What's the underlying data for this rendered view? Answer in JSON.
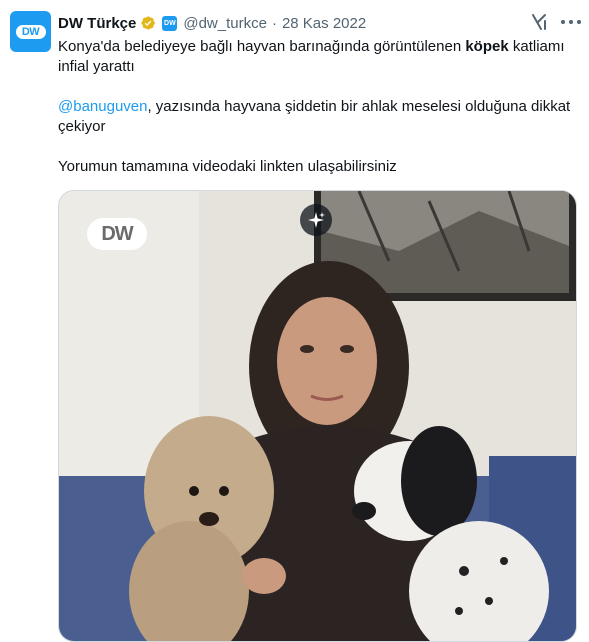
{
  "tweet": {
    "avatar_text": "DW",
    "author_name": "DW Türkçe",
    "affiliate_badge": "DW",
    "handle": "@dw_turkce",
    "separator": "·",
    "date": "28 Kas 2022",
    "line1_before": "Konya'da belediyeye bağlı hayvan barınağında görüntülenen ",
    "line1_bold": "köpek",
    "line1_after": " katliamı infial yarattı",
    "mention": "@banuguven",
    "line2_after": ", yazısında hayvana şiddetin bir ahlak meselesi olduğuna dikkat çekiyor",
    "line3": "Yorumun tamamına videodaki linkten ulaşabilirsiniz"
  },
  "media": {
    "logo_text": "DW"
  },
  "colors": {
    "accent": "#1d9bf0",
    "muted": "#536471",
    "text": "#0f1419",
    "verified_gold": "#e2b719"
  },
  "icons": {
    "verified": "verified-gold-badge-icon",
    "affiliate": "dw-affiliate-badge-icon",
    "grok": "grok-icon",
    "more": "more-options-icon",
    "sparkle": "sparkle-icon"
  }
}
